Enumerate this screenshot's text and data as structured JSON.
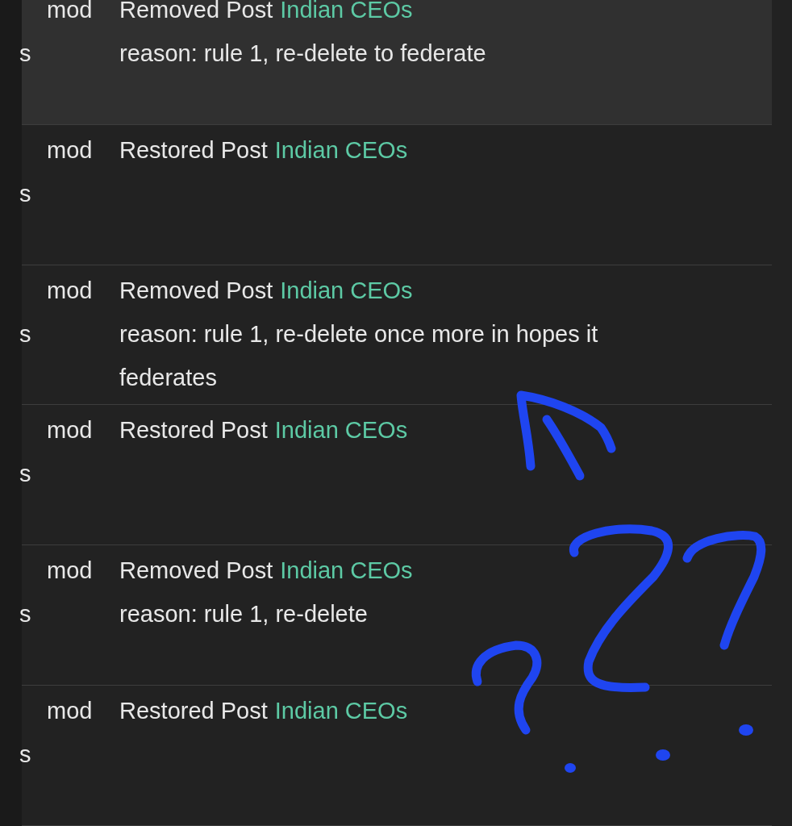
{
  "rows": [
    {
      "highlighted": true,
      "side_text": "s",
      "moderator": "mod",
      "action": "Removed Post",
      "community": "Indian CEOs",
      "reason": "reason: rule 1, re-delete to federate"
    },
    {
      "highlighted": false,
      "side_text": "s",
      "moderator": "mod",
      "action": "Restored Post",
      "community": "Indian CEOs"
    },
    {
      "highlighted": false,
      "side_text": "s",
      "moderator": "mod",
      "action": "Removed Post",
      "community": "Indian CEOs",
      "reason": "reason: rule 1, re-delete once more in hopes it federates"
    },
    {
      "highlighted": false,
      "side_text": "s",
      "moderator": "mod",
      "action": "Restored Post",
      "community": "Indian CEOs"
    },
    {
      "highlighted": false,
      "side_text": "s",
      "moderator": "mod",
      "action": "Removed Post",
      "community": "Indian CEOs",
      "reason": "reason: rule 1, re-delete"
    },
    {
      "highlighted": false,
      "side_text": "s",
      "moderator": "mod",
      "action": "Restored Post",
      "community": "Indian CEOs"
    }
  ]
}
